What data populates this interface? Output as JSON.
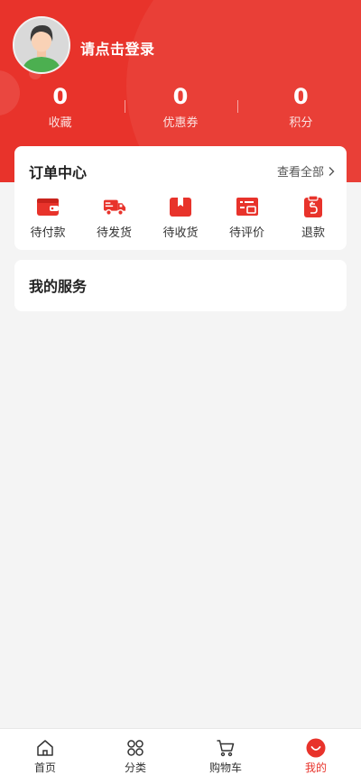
{
  "header": {
    "login_text": "请点击登录",
    "bg_color": "#e8332b"
  },
  "stats": [
    {
      "value": "0",
      "label": "收藏"
    },
    {
      "value": "0",
      "label": "优惠券"
    },
    {
      "value": "0",
      "label": "积分"
    }
  ],
  "orders": {
    "title": "订单中心",
    "view_all": "查看全部",
    "items": [
      {
        "label": "待付款",
        "icon": "wallet-icon"
      },
      {
        "label": "待发货",
        "icon": "truck-icon"
      },
      {
        "label": "待收货",
        "icon": "box-icon"
      },
      {
        "label": "待评价",
        "icon": "review-icon"
      },
      {
        "label": "退款",
        "icon": "refund-icon"
      }
    ]
  },
  "services": {
    "title": "我的服务"
  },
  "tabbar": {
    "items": [
      {
        "label": "首页",
        "icon": "home-icon"
      },
      {
        "label": "分类",
        "icon": "category-icon"
      },
      {
        "label": "购物车",
        "icon": "cart-icon"
      },
      {
        "label": "我的",
        "icon": "profile-icon",
        "active": true
      }
    ]
  },
  "colors": {
    "accent": "#e8332b",
    "background": "#f4f4f4"
  }
}
